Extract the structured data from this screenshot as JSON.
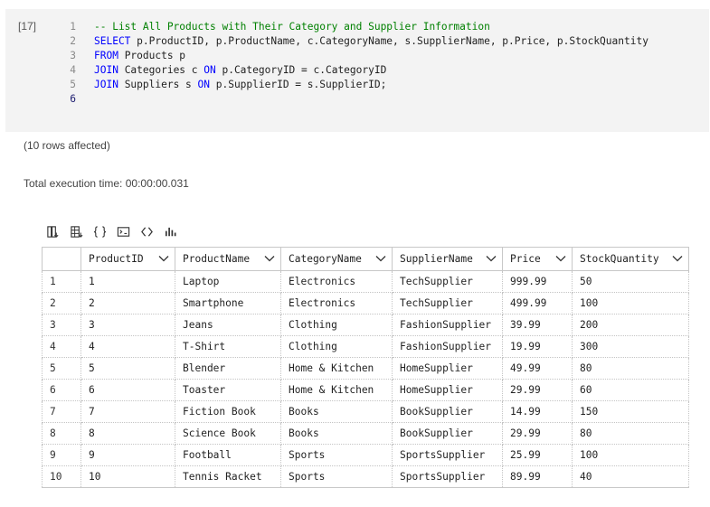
{
  "cell": {
    "execution_count": "[17]",
    "lines": [
      {
        "num": "1",
        "tokens": [
          {
            "t": "-- List All Products with Their Category and Supplier Information",
            "c": "comment"
          }
        ]
      },
      {
        "num": "2",
        "tokens": [
          {
            "t": "SELECT",
            "c": "kw"
          },
          {
            "t": " p.ProductID, p.ProductName, c.CategoryName, s.SupplierName, p.Price, p.StockQuantity",
            "c": "plain"
          }
        ]
      },
      {
        "num": "3",
        "tokens": [
          {
            "t": "FROM",
            "c": "kw"
          },
          {
            "t": " Products p",
            "c": "plain"
          }
        ]
      },
      {
        "num": "4",
        "tokens": [
          {
            "t": "JOIN",
            "c": "kw"
          },
          {
            "t": " Categories c ",
            "c": "plain"
          },
          {
            "t": "ON",
            "c": "kw"
          },
          {
            "t": " p.CategoryID = c.CategoryID",
            "c": "plain"
          }
        ]
      },
      {
        "num": "5",
        "tokens": [
          {
            "t": "JOIN",
            "c": "kw"
          },
          {
            "t": " Suppliers s ",
            "c": "plain"
          },
          {
            "t": "ON",
            "c": "kw"
          },
          {
            "t": " p.SupplierID = s.SupplierID;",
            "c": "plain"
          }
        ]
      },
      {
        "num": "6",
        "tokens": []
      }
    ]
  },
  "messages": {
    "rows_affected": "(10 rows affected)",
    "execution_time": "Total execution time: 00:00:00.031"
  },
  "toolbar": {
    "buttons": [
      {
        "name": "save-as-csv-icon"
      },
      {
        "name": "save-as-excel-icon"
      },
      {
        "name": "save-as-json-icon"
      },
      {
        "name": "save-as-xml-icon"
      },
      {
        "name": "copy-icon"
      },
      {
        "name": "chart-icon"
      }
    ]
  },
  "grid": {
    "columns": [
      "ProductID",
      "ProductName",
      "CategoryName",
      "SupplierName",
      "Price",
      "StockQuantity"
    ],
    "rows": [
      [
        "1",
        "1",
        "Laptop",
        "Electronics",
        "TechSupplier",
        "999.99",
        "50"
      ],
      [
        "2",
        "2",
        "Smartphone",
        "Electronics",
        "TechSupplier",
        "499.99",
        "100"
      ],
      [
        "3",
        "3",
        "Jeans",
        "Clothing",
        "FashionSupplier",
        "39.99",
        "200"
      ],
      [
        "4",
        "4",
        "T-Shirt",
        "Clothing",
        "FashionSupplier",
        "19.99",
        "300"
      ],
      [
        "5",
        "5",
        "Blender",
        "Home & Kitchen",
        "HomeSupplier",
        "49.99",
        "80"
      ],
      [
        "6",
        "6",
        "Toaster",
        "Home & Kitchen",
        "HomeSupplier",
        "29.99",
        "60"
      ],
      [
        "7",
        "7",
        "Fiction Book",
        "Books",
        "BookSupplier",
        "14.99",
        "150"
      ],
      [
        "8",
        "8",
        "Science Book",
        "Books",
        "BookSupplier",
        "29.99",
        "80"
      ],
      [
        "9",
        "9",
        "Football",
        "Sports",
        "SportsSupplier",
        "25.99",
        "100"
      ],
      [
        "10",
        "10",
        "Tennis Racket",
        "Sports",
        "SportsSupplier",
        "89.99",
        "40"
      ]
    ]
  }
}
